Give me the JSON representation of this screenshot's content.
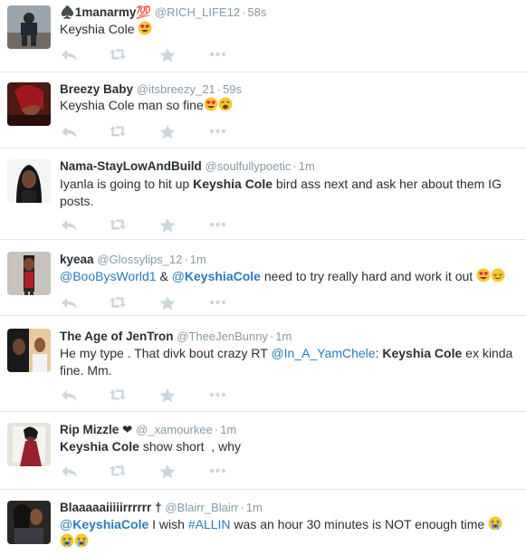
{
  "tweets": [
    {
      "name": "♠️1manarmy💯",
      "handle": "@RICH_LIFE12",
      "time": "58s",
      "text_a": "Keyshia Cole"
    },
    {
      "name": "Breezy Baby",
      "handle": "@itsbreezy_21",
      "time": "59s",
      "text_a": "Keyshia Cole man so fine"
    },
    {
      "name": "Nama-StayLowAndBuild",
      "handle": "@soulfullypoetic",
      "time": "1m",
      "text_a": "Iyanla is going to hit up ",
      "text_b": "Keyshia Cole",
      "text_c": " bird ass next and ask her about them IG posts."
    },
    {
      "name": "kyeaa",
      "handle": "@Glossylips_12",
      "time": "1m",
      "mention1": "@BooBysWorld1",
      "amp": " & ",
      "mention2_at": "@",
      "mention2_bold": "KeyshiaCole",
      "text_c": " need to try really hard and work it out "
    },
    {
      "name": "The Age of JenTron",
      "handle": "@TheeJenBunny",
      "time": "1m",
      "text_a": "He my type . That divk bout crazy RT ",
      "mention": "@In_A_YamChele",
      "text_b": ": ",
      "bold": "Keyshia Cole",
      "text_c": " ex kinda fine. Mm."
    },
    {
      "name": "Rip Mizzle ❤",
      "handle": "@_xamourkee",
      "time": "1m",
      "bold": "Keyshia Cole",
      "text_c": " show short  , why"
    },
    {
      "name": "Blaaaaaiiiiirrrrrr †",
      "handle": "@Blairr_Blairr",
      "time": "1m",
      "mention_at": "@",
      "mention_bold": "KeyshiaCole",
      "text_a": " I wish ",
      "hashtag": "#ALLIN",
      "text_b": " was an hour 30 minutes is NOT enough time "
    }
  ],
  "separator": "·",
  "icons": [
    "reply-icon",
    "retweet-icon",
    "favorite-icon",
    "more-icon",
    "heart-eyes-emoji",
    "weary-emoji",
    "relieved-emoji",
    "crying-emoji"
  ],
  "colors": {
    "link": "#2b7bb9",
    "meta": "#8899a6",
    "text": "#292f33",
    "action": "#ccd6dd",
    "divider": "#e1e8ed"
  }
}
